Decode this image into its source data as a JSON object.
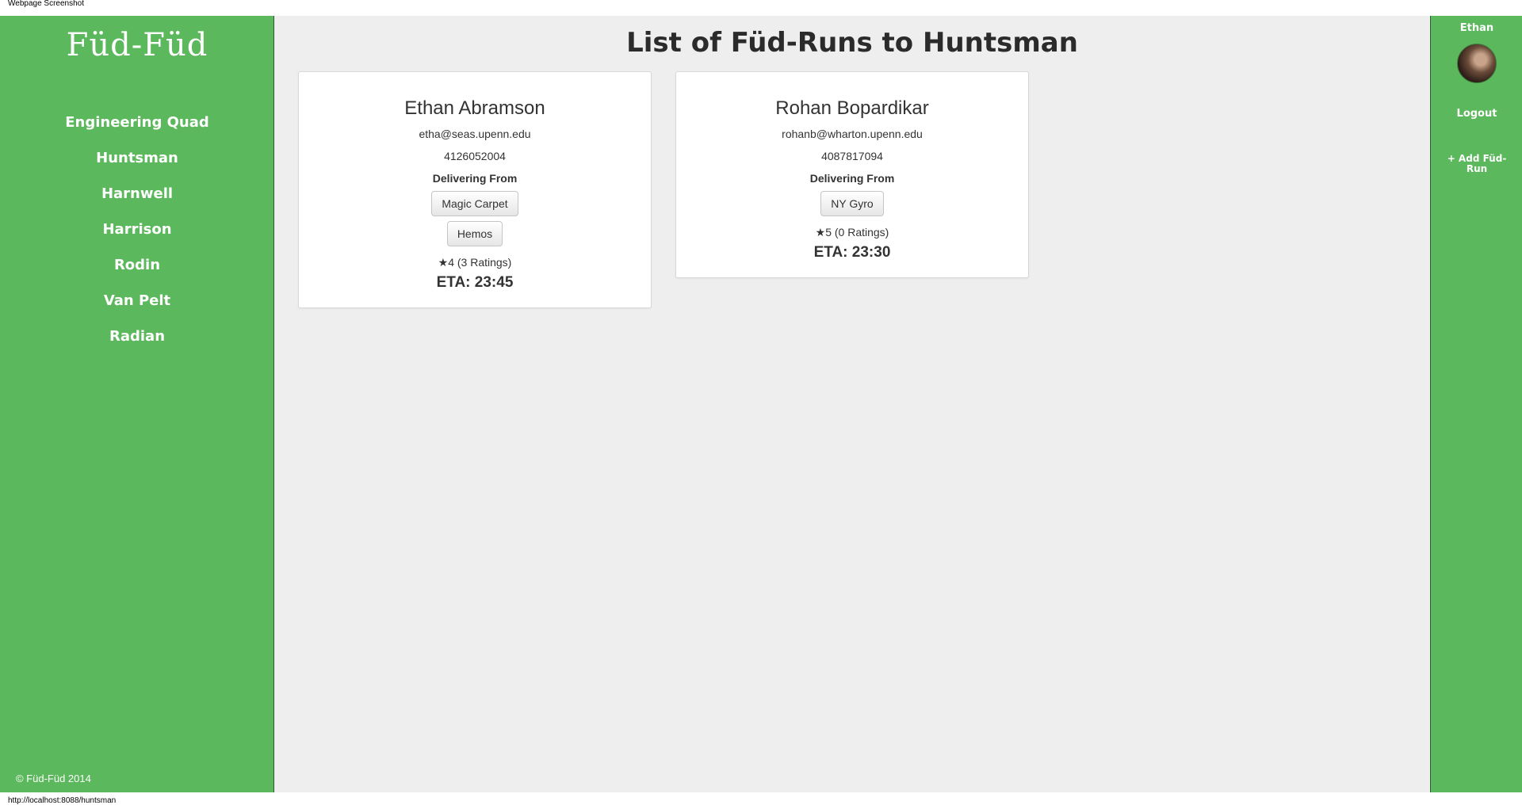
{
  "screenshot_label": "Webpage Screenshot",
  "sidebar": {
    "logo": "Füd-Füd",
    "items": [
      {
        "label": "Engineering Quad"
      },
      {
        "label": "Huntsman"
      },
      {
        "label": "Harnwell"
      },
      {
        "label": "Harrison"
      },
      {
        "label": "Rodin"
      },
      {
        "label": "Van Pelt"
      },
      {
        "label": "Radian"
      }
    ],
    "copyright": "© Füd-Füd 2014"
  },
  "main": {
    "title": "List of Füd-Runs to Huntsman",
    "cards": [
      {
        "name": "Ethan Abramson",
        "email": "etha@seas.upenn.edu",
        "phone": "4126052004",
        "delivering_label": "Delivering From",
        "restaurants": [
          "Magic Carpet",
          "Hemos"
        ],
        "rating": "★4 (3 Ratings)",
        "eta": "ETA: 23:45"
      },
      {
        "name": "Rohan Bopardikar",
        "email": "rohanb@wharton.upenn.edu",
        "phone": "4087817094",
        "delivering_label": "Delivering From",
        "restaurants": [
          "NY Gyro"
        ],
        "rating": "★5 (0 Ratings)",
        "eta": "ETA: 23:30"
      }
    ]
  },
  "user_panel": {
    "name": "Ethan",
    "logout_label": "Logout",
    "add_run_label": "+ Add Füd-Run"
  },
  "status_url": "http://localhost:8088/huntsman",
  "colors": {
    "sidebar_green": "#5cb85c",
    "main_bg": "#eeeeee"
  }
}
